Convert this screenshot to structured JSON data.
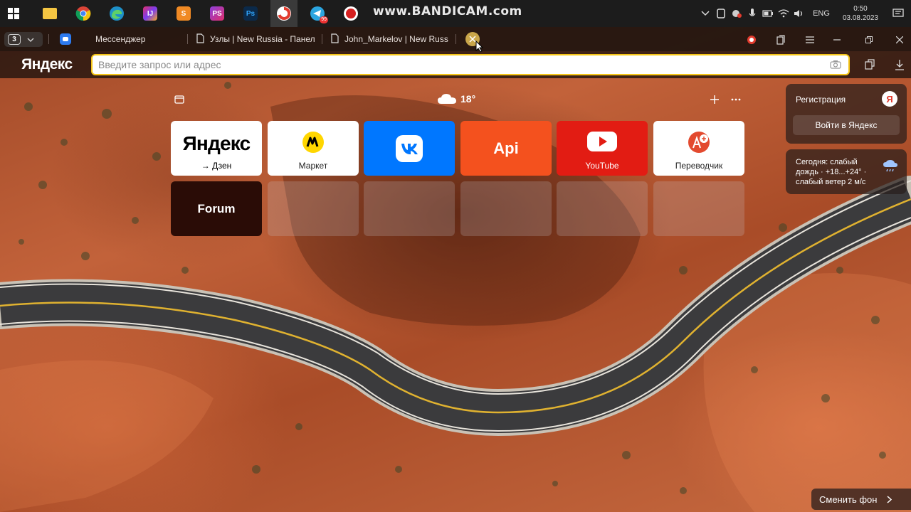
{
  "taskbar": {
    "apps": [
      {
        "name": "start-button",
        "icon": "windows-icon"
      },
      {
        "name": "explorer",
        "icon": "folder-icon",
        "color": "#f4c542"
      },
      {
        "name": "chrome",
        "icon": "chrome-icon",
        "color": "#4285f4"
      },
      {
        "name": "edge",
        "icon": "edge-icon",
        "color": "#1e90c8"
      },
      {
        "name": "intellij",
        "icon": "intellij-icon",
        "color": "#e0306b",
        "glyph": "IJ"
      },
      {
        "name": "sublime",
        "icon": "sublime-icon",
        "color": "#f08a24",
        "glyph": "S"
      },
      {
        "name": "phpstorm",
        "icon": "phpstorm-icon",
        "color": "#8e3fdc",
        "glyph": "PS"
      },
      {
        "name": "photoshop",
        "icon": "photoshop-icon",
        "color": "#0b2a4a",
        "glyph": "Ps"
      },
      {
        "name": "yandex-browser",
        "icon": "yandex-browser-icon",
        "color": "#e23b2e"
      },
      {
        "name": "telegram",
        "icon": "telegram-icon",
        "color": "#2ba5e0",
        "badge": "99"
      },
      {
        "name": "bandicam",
        "icon": "record-icon",
        "color": "#d62020"
      }
    ],
    "watermark": "www.BANDICAM.com",
    "tray": {
      "language": "ENG",
      "time": "0:50",
      "date": "03.08.2023"
    }
  },
  "browser": {
    "tab_count": "3",
    "tabs": [
      {
        "title": "Мессенджер",
        "icon": "messenger-icon"
      },
      {
        "title": "Узлы | New Russia - Панел",
        "icon": "page-icon"
      },
      {
        "title": "John_Markelov | New Russ",
        "icon": "page-icon"
      }
    ],
    "logo": "Яндекс",
    "search_placeholder": "Введите запрос или адрес",
    "accent": "#f5c518"
  },
  "ntp": {
    "weather_temp": "18°",
    "tiles": [
      {
        "title": "Яндекс",
        "label": "→ Дзен",
        "bg": "#ffffff",
        "fg": "#000000"
      },
      {
        "title": "",
        "label": "Маркет",
        "bg": "#ffffff",
        "fg": "#222222"
      },
      {
        "title": "",
        "label": "",
        "bg": "#0077ff",
        "fg": "#ffffff"
      },
      {
        "title": "Api",
        "label": "",
        "bg": "#f4511e",
        "fg": "#ffffff"
      },
      {
        "title": "",
        "label": "YouTube",
        "bg": "#e21c13",
        "fg": "#ffffff"
      },
      {
        "title": "",
        "label": "Переводчик",
        "bg": "#ffffff",
        "fg": "#222222"
      },
      {
        "title": "Forum",
        "label": "",
        "bg": "#2a0c06",
        "fg": "#ffffff"
      }
    ],
    "account_panel": {
      "title": "Регистрация",
      "button": "Войти в Яндекс"
    },
    "weather_panel": {
      "text": "Сегодня: слабый дождь · +18...+24° · слабый ветер 2 м/с"
    },
    "change_background": "Сменить фон"
  }
}
